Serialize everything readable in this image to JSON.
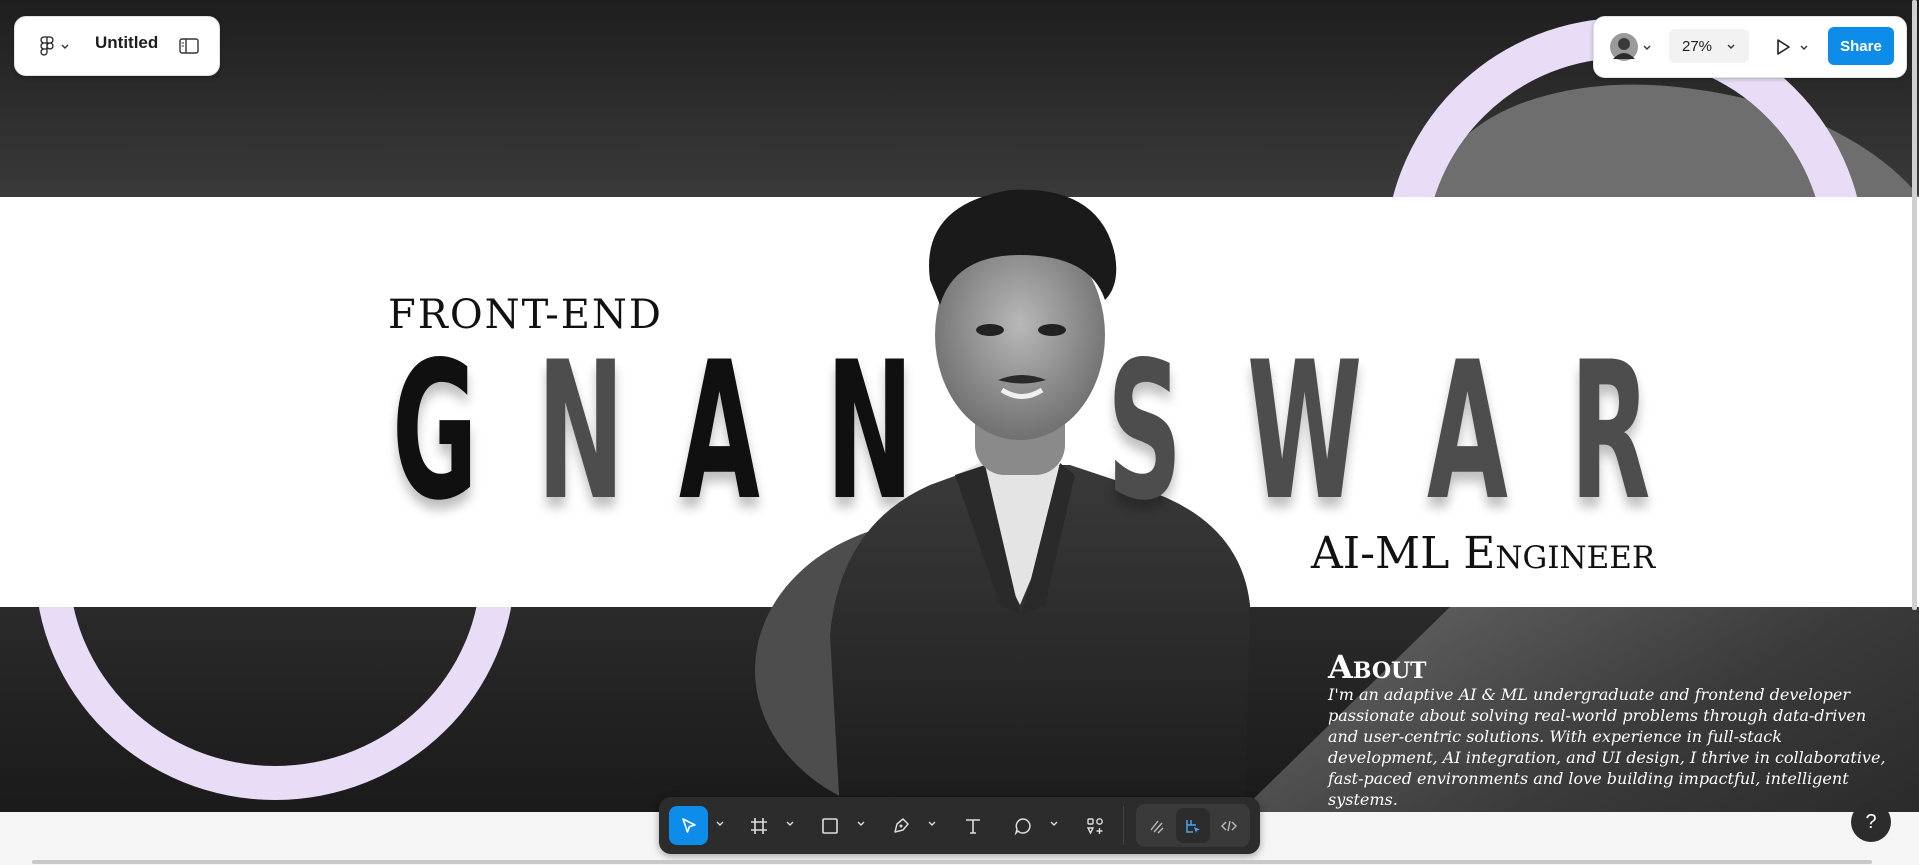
{
  "file_panel": {
    "title": "Untitled",
    "menu_icon": "figma-logo-icon",
    "sidebar_icon": "sidebar-toggle-icon"
  },
  "right_panel": {
    "zoom": "27%",
    "share_label": "Share",
    "play_icon": "play-icon",
    "avatar_icon": "user-avatar"
  },
  "design": {
    "kicker": "FRONT-END",
    "name_letters": [
      "G",
      "N",
      "A",
      "N",
      "S",
      "W",
      "A",
      "R"
    ],
    "subtitle": "AI-ML Engineer",
    "about_heading": "About",
    "about_text": "I'm an adaptive AI & ML undergraduate and frontend developer passionate about solving real-world problems through data-driven and user-centric solutions. With experience in full-stack development, AI integration, and UI design, I thrive in collaborative, fast-paced environments and love building impactful, intelligent systems.",
    "accent_color": "#e8dcf7"
  },
  "toolbar": {
    "tools": [
      "move-tool",
      "frame-tool",
      "rectangle-tool",
      "pen-tool",
      "text-tool",
      "comment-tool",
      "actions-tool"
    ],
    "modes": [
      "draw-mode",
      "design-mode",
      "dev-mode"
    ],
    "active_tool": "move-tool",
    "active_mode": "design-mode"
  },
  "help": {
    "label": "?"
  }
}
